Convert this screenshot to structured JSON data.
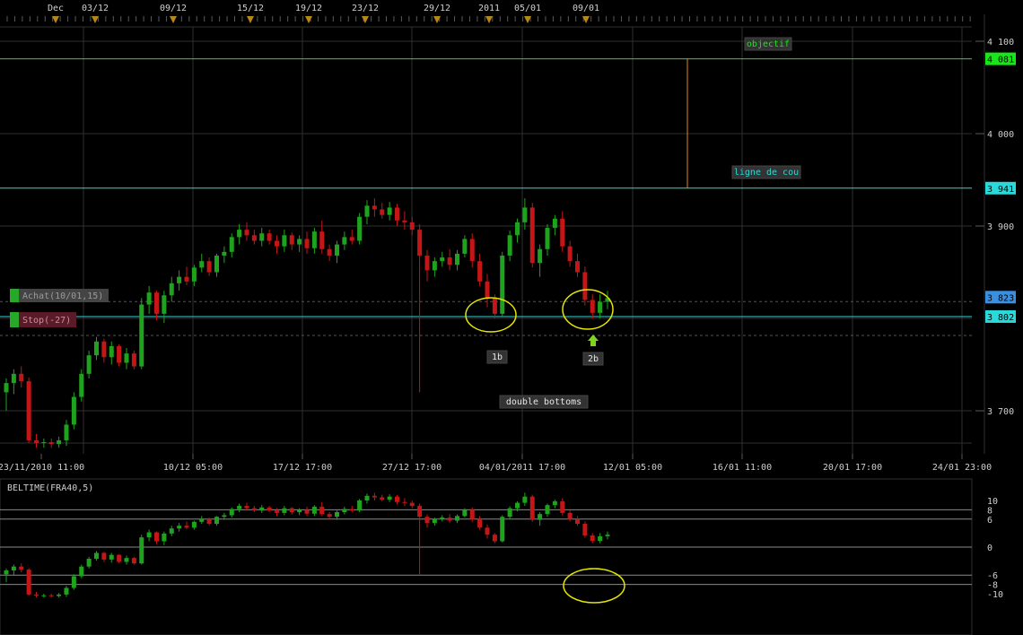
{
  "top_axis": {
    "labels": [
      "Dec",
      "03/12",
      "09/12",
      "15/12",
      "19/12",
      "23/12",
      "29/12",
      "2011",
      "05/01",
      "09/01"
    ]
  },
  "price_axis": {
    "ticks": [
      "4 100",
      "4 000",
      "3 900",
      "3 700"
    ],
    "tags": [
      {
        "label": "4 081",
        "color": "#19e619"
      },
      {
        "label": "3 941",
        "color": "#2ad9d9"
      },
      {
        "label": "3 823",
        "color": "#3b8fe0"
      },
      {
        "label": "3 802",
        "color": "#2ad9d9"
      }
    ]
  },
  "time_axis": {
    "labels": [
      "23/11/2010 11:00",
      "10/12 05:00",
      "17/12 17:00",
      "27/12 17:00",
      "04/01/2011 17:00",
      "12/01 05:00",
      "16/01 11:00",
      "20/01 17:00",
      "24/01 23:00"
    ]
  },
  "annotations": {
    "objectif": "objectif",
    "neckline": "ligne de cou",
    "bottom1": "1b",
    "bottom2": "2b",
    "pattern": "double bottoms"
  },
  "orders": {
    "buy": "Achat(10/01,15)",
    "stop": "Stop(-27)"
  },
  "indicator": {
    "title": "BELTIME(FRA40,5)",
    "ticks": [
      "10",
      "8",
      "6",
      "0",
      "-6",
      "-8",
      "-10"
    ]
  },
  "colors": {
    "up": "#1fa31f",
    "down": "#c41616",
    "grid": "#2f2f2f",
    "target": "#19e619",
    "neckline": "#2ad9d9",
    "ellipse": "#e6e600"
  },
  "chart_data": {
    "type": "candlestick",
    "symbol": "FRA40",
    "ylim": [
      3660,
      4140
    ],
    "levels": {
      "objectif": 4081,
      "neckline": 3941,
      "entry": 3823,
      "stop": 3802
    },
    "candles": [
      [
        3720,
        3735,
        3700,
        3730
      ],
      [
        3730,
        3745,
        3718,
        3740
      ],
      [
        3740,
        3748,
        3725,
        3732
      ],
      [
        3732,
        3736,
        3665,
        3668
      ],
      [
        3668,
        3675,
        3660,
        3665
      ],
      [
        3665,
        3670,
        3660,
        3666
      ],
      [
        3666,
        3670,
        3660,
        3664
      ],
      [
        3664,
        3672,
        3660,
        3668
      ],
      [
        3668,
        3690,
        3662,
        3685
      ],
      [
        3685,
        3720,
        3680,
        3715
      ],
      [
        3715,
        3745,
        3710,
        3740
      ],
      [
        3740,
        3765,
        3735,
        3760
      ],
      [
        3760,
        3780,
        3755,
        3775
      ],
      [
        3775,
        3778,
        3752,
        3758
      ],
      [
        3758,
        3775,
        3750,
        3770
      ],
      [
        3770,
        3772,
        3748,
        3752
      ],
      [
        3752,
        3768,
        3745,
        3762
      ],
      [
        3762,
        3765,
        3745,
        3748
      ],
      [
        3748,
        3822,
        3745,
        3815
      ],
      [
        3815,
        3835,
        3805,
        3828
      ],
      [
        3828,
        3830,
        3798,
        3805
      ],
      [
        3805,
        3830,
        3795,
        3825
      ],
      [
        3825,
        3845,
        3818,
        3838
      ],
      [
        3838,
        3852,
        3830,
        3845
      ],
      [
        3845,
        3856,
        3836,
        3840
      ],
      [
        3840,
        3858,
        3835,
        3855
      ],
      [
        3855,
        3870,
        3850,
        3862
      ],
      [
        3862,
        3866,
        3846,
        3850
      ],
      [
        3850,
        3870,
        3845,
        3868
      ],
      [
        3868,
        3878,
        3860,
        3872
      ],
      [
        3872,
        3892,
        3866,
        3888
      ],
      [
        3888,
        3902,
        3880,
        3896
      ],
      [
        3896,
        3904,
        3884,
        3890
      ],
      [
        3890,
        3896,
        3880,
        3884
      ],
      [
        3884,
        3898,
        3878,
        3892
      ],
      [
        3892,
        3896,
        3880,
        3884
      ],
      [
        3884,
        3890,
        3870,
        3878
      ],
      [
        3878,
        3896,
        3872,
        3890
      ],
      [
        3890,
        3893,
        3874,
        3880
      ],
      [
        3880,
        3890,
        3872,
        3886
      ],
      [
        3886,
        3894,
        3870,
        3876
      ],
      [
        3876,
        3898,
        3870,
        3894
      ],
      [
        3894,
        3906,
        3870,
        3875
      ],
      [
        3875,
        3880,
        3862,
        3868
      ],
      [
        3868,
        3884,
        3860,
        3880
      ],
      [
        3880,
        3894,
        3874,
        3888
      ],
      [
        3888,
        3896,
        3880,
        3884
      ],
      [
        3884,
        3914,
        3880,
        3910
      ],
      [
        3910,
        3928,
        3902,
        3922
      ],
      [
        3922,
        3930,
        3910,
        3918
      ],
      [
        3918,
        3925,
        3908,
        3912
      ],
      [
        3912,
        3926,
        3906,
        3920
      ],
      [
        3920,
        3924,
        3900,
        3906
      ],
      [
        3906,
        3916,
        3896,
        3904
      ],
      [
        3904,
        3910,
        3890,
        3896
      ],
      [
        3896,
        3902,
        3720,
        3868
      ],
      [
        3868,
        3874,
        3840,
        3852
      ],
      [
        3852,
        3866,
        3845,
        3862
      ],
      [
        3862,
        3872,
        3856,
        3866
      ],
      [
        3866,
        3875,
        3852,
        3858
      ],
      [
        3858,
        3874,
        3852,
        3870
      ],
      [
        3870,
        3890,
        3866,
        3886
      ],
      [
        3886,
        3892,
        3855,
        3862
      ],
      [
        3862,
        3870,
        3835,
        3840
      ],
      [
        3840,
        3848,
        3812,
        3822
      ],
      [
        3822,
        3826,
        3800,
        3805
      ],
      [
        3805,
        3872,
        3802,
        3868
      ],
      [
        3868,
        3895,
        3862,
        3890
      ],
      [
        3890,
        3908,
        3882,
        3904
      ],
      [
        3904,
        3930,
        3896,
        3920
      ],
      [
        3920,
        3925,
        3855,
        3860
      ],
      [
        3860,
        3880,
        3845,
        3875
      ],
      [
        3875,
        3902,
        3868,
        3898
      ],
      [
        3898,
        3912,
        3890,
        3908
      ],
      [
        3908,
        3916,
        3872,
        3878
      ],
      [
        3878,
        3884,
        3856,
        3862
      ],
      [
        3862,
        3870,
        3845,
        3850
      ],
      [
        3850,
        3856,
        3814,
        3820
      ],
      [
        3820,
        3826,
        3800,
        3806
      ],
      [
        3806,
        3826,
        3800,
        3818
      ],
      [
        3818,
        3830,
        3810,
        3822
      ]
    ]
  }
}
